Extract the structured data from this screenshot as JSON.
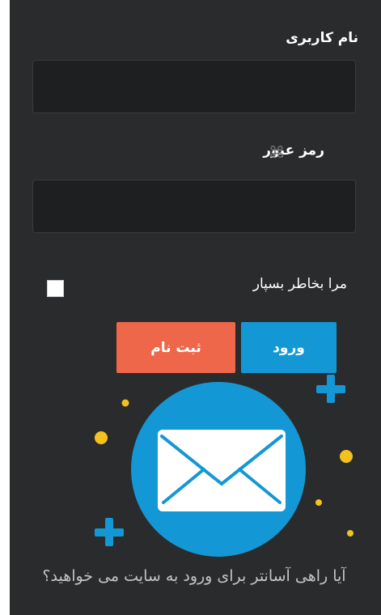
{
  "form": {
    "username_label": "نام کاربری",
    "password_label": "رمز عبور",
    "username_value": "",
    "password_value": "",
    "remember_label": "مرا بخاطر بسپار",
    "remember_checked": false
  },
  "buttons": {
    "login_label": "ورود",
    "register_label": "ثبت نام"
  },
  "icons": {
    "password_icon": "command-icon",
    "illustration": "envelope-icon"
  },
  "help": {
    "text": "آیا راهی آسانتر برای ورود به سایت می خواهید؟"
  },
  "colors": {
    "panel_background": "#2a2b2d",
    "login_button": "#1497d5",
    "register_button": "#ef674b",
    "illustration_circle": "#1497d5",
    "accent_yellow": "#f4c21f"
  }
}
